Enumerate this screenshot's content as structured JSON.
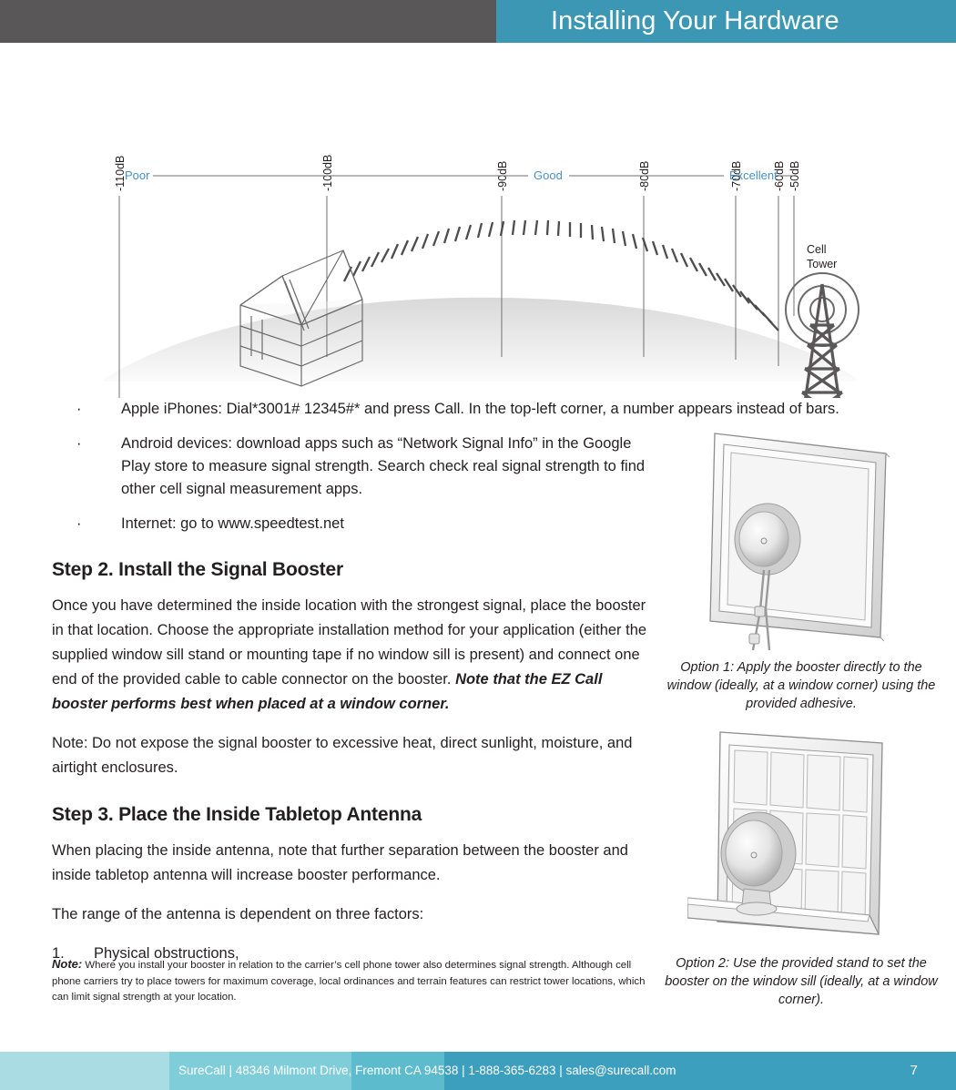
{
  "header": {
    "title": "Installing Your Hardware"
  },
  "diagram": {
    "scale_labels": [
      "-110dB",
      "-100dB",
      "-90dB",
      "-80dB",
      "-70dB",
      "-60dB",
      "-50dB"
    ],
    "quality_labels": [
      "Poor",
      "Good",
      "Excellent"
    ],
    "tower_label_line1": "Cell",
    "tower_label_line2": "Tower",
    "label_color": "#4a90c4",
    "tick_color": "#595757"
  },
  "bullets": [
    "Apple iPhones: Dial*3001# 12345#* and press Call. In the top-left corner, a number appears instead of bars.",
    "Android devices: download apps such as “Network Signal Info” in the Google Play store to measure signal strength. Search check real signal strength to find other cell signal measurement apps.",
    "Internet: go to www.speedtest.net"
  ],
  "bullet_marker": "·",
  "step2": {
    "heading": "Step 2. Install the Signal Booster",
    "paragraph_plain": "Once you have determined the inside location with the strongest signal, place the booster in that location. Choose the appropriate installation method for your application (either the supplied window sill stand or mounting tape if no window sill is present) and connect one end of the provided cable to cable connector on the booster. ",
    "paragraph_emphasis": "Note that the EZ Call booster performs best when placed at a window corner.",
    "note": "Note: Do not expose the signal booster to excessive heat, direct sunlight, moisture, and airtight enclosures."
  },
  "step3": {
    "heading": "Step 3. Place the Inside Tabletop Antenna",
    "paragraph1": "When placing the inside antenna, note that further separation between the booster and inside tabletop antenna will increase booster performance.",
    "paragraph2": "The range of the antenna is dependent on three factors:",
    "list": [
      {
        "num": "1.",
        "text": "Physical obstructions,"
      }
    ]
  },
  "footnote": {
    "label": "Note:",
    "text": " Where you install your booster in relation to the carrier’s cell phone tower also determines signal strength. Although cell phone carriers try to place towers for maximum coverage, local ordinances and terrain features can restrict tower locations, which can limit signal strength at your location."
  },
  "figures": [
    {
      "caption": "Option 1: Apply the booster directly to the window (ideally, at a window corner) using the provided adhesive."
    },
    {
      "caption": "Option 2: Use the provided stand to set the booster on the window sill (ideally, at a window corner)."
    }
  ],
  "footer": {
    "text": "SureCall | 48346 Milmont Drive, Fremont CA 94538 | 1-888-365-6283 | sales@surecall.com",
    "page": "7",
    "colors": [
      "#a9dce3",
      "#7fcdd8",
      "#5cbccd",
      "#3b9fbd"
    ]
  }
}
